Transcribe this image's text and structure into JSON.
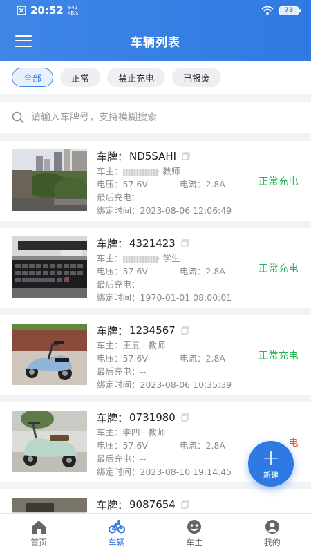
{
  "status_bar": {
    "time": "20:52",
    "speed_value": "642",
    "speed_unit": "KB/s",
    "battery": "73"
  },
  "header": {
    "title": "车辆列表"
  },
  "filters": [
    {
      "label": "全部",
      "active": true
    },
    {
      "label": "正常",
      "active": false
    },
    {
      "label": "禁止充电",
      "active": false
    },
    {
      "label": "已报废",
      "active": false
    }
  ],
  "search": {
    "placeholder": "请输入车牌号，支持模糊搜索"
  },
  "vehicles": [
    {
      "plate_label": "车牌：",
      "plate": "ND5SAHI",
      "owner_label": "车主：",
      "owner": "· 教师",
      "voltage": "电压：57.6V",
      "current": "电流：2.8A",
      "last_charge": "最后充电：--",
      "bind_time": "绑定时间：2023-08-06 12:06:49",
      "status": "正常充电",
      "image": "city-view"
    },
    {
      "plate_label": "车牌：",
      "plate": "4321423",
      "owner_label": "车主：",
      "owner": "· 学生",
      "voltage": "电压：57.6V",
      "current": "电流：2.8A",
      "last_charge": "最后充电：--",
      "bind_time": "绑定时间：1970-01-01 08:00:01",
      "status": "正常充电",
      "image": "keyboard"
    },
    {
      "plate_label": "车牌：",
      "plate": "1234567",
      "owner_label": "车主：",
      "owner": "王五 · 教师",
      "voltage": "电压：57.6V",
      "current": "电流：2.8A",
      "last_charge": "最后充电：--",
      "bind_time": "绑定时间：2023-08-06 10:35:39",
      "status": "正常充电",
      "image": "blue-scooter"
    },
    {
      "plate_label": "车牌：",
      "plate": "0731980",
      "owner_label": "车主：",
      "owner": "李四 · 教师",
      "voltage": "电压：57.6V",
      "current": "电流：2.8A",
      "last_charge": "最后充电：--",
      "bind_time": "绑定时间：2023-08-10 19:14:45",
      "status": "电",
      "image": "mint-scooter"
    },
    {
      "plate_label": "车牌：",
      "plate": "9087654",
      "image": "scooter-partial"
    }
  ],
  "fab": {
    "icon": "plus-icon",
    "label": "新建"
  },
  "tabs": [
    {
      "label": "首页",
      "icon": "home-icon",
      "active": false
    },
    {
      "label": "车辆",
      "icon": "bicycle-icon",
      "active": true
    },
    {
      "label": "车主",
      "icon": "owner-icon",
      "active": false
    },
    {
      "label": "我的",
      "icon": "user-icon",
      "active": false
    }
  ],
  "colors": {
    "primary": "#2f7ae2",
    "status_ok": "#25b35a",
    "status_alert": "#e45b3a"
  }
}
